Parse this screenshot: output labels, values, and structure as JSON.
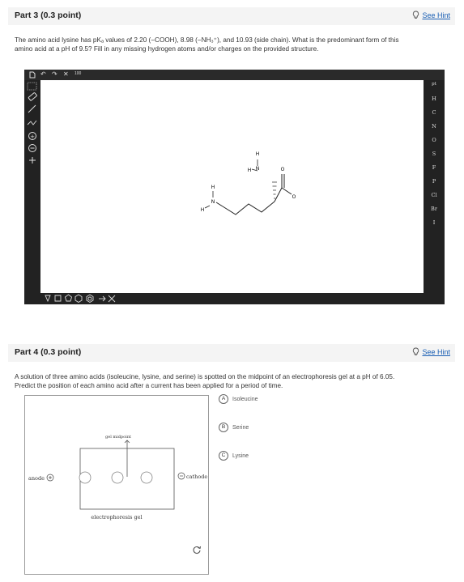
{
  "part3": {
    "title": "Part 3   (0.3 point)",
    "hint": "See Hint",
    "question_line1": "The amino acid lysine has pKₐ values of 2.20 (−COOH), 8.98 (−NH₃⁺), and 10.93 (side chain). What is the predominant form of this",
    "question_line2": "amino acid at a pH of 9.5? Fill in any missing hydrogen atoms and/or charges on the provided structure.",
    "sketcher": {
      "top_tools": [
        "new-doc",
        "undo",
        "redo",
        "clear",
        "zoom"
      ],
      "zoom_label": "100",
      "elements": [
        "H",
        "C",
        "N",
        "O",
        "S",
        "F",
        "P",
        "Cl",
        "Br",
        "I"
      ],
      "periodic_label": "pt",
      "atom_labels": {
        "h_top": "H",
        "n_top": "N",
        "h_top2": "H",
        "h_left": "H",
        "n_left": "N",
        "h_left2": "H",
        "h_bottom": "H",
        "o_top": "O",
        "o_right": "O"
      }
    }
  },
  "part4": {
    "title": "Part 4   (0.3 point)",
    "hint": "See Hint",
    "question_line1": "A solution of three amino acids (isoleucine, lysine, and serine) is spotted on the midpoint of an electrophoresis gel at a pH of 6.05.",
    "question_line2": "Predict the position of each amino acid after a current has been applied for a period of time.",
    "gel": {
      "midpoint_label": "gel midpoint",
      "anode_label": "anode",
      "cathode_label": "cathode",
      "gel_label": "electrophoresis gel",
      "plus": "+",
      "minus": "−"
    },
    "options": [
      {
        "letter": "A",
        "label": "Isoleucine"
      },
      {
        "letter": "B",
        "label": "Serine"
      },
      {
        "letter": "C",
        "label": "Lysine"
      }
    ]
  }
}
